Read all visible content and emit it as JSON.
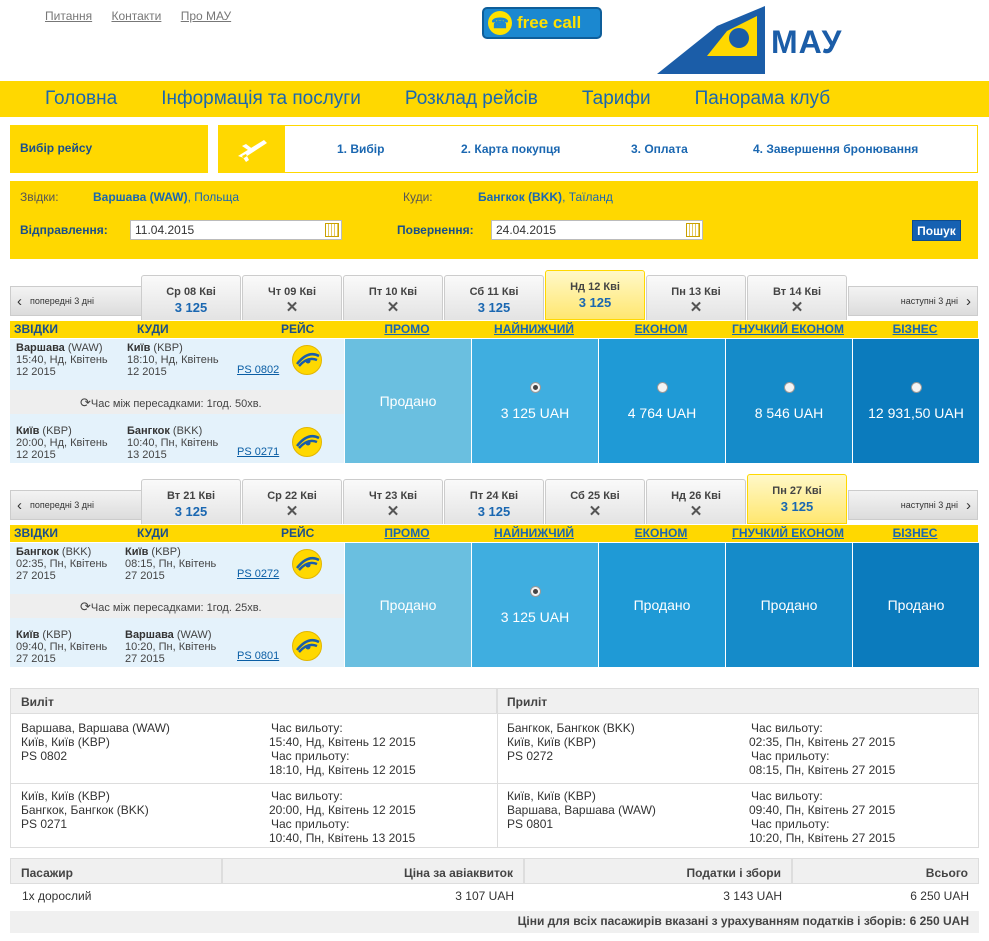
{
  "top_links": [
    "Питання",
    "Контакти",
    "Про МАУ"
  ],
  "freecall": "free call",
  "brand": "МАУ",
  "nav": [
    "Головна",
    "Інформація та послуги",
    "Розклад рейсів",
    "Тарифи",
    "Панорама клуб"
  ],
  "steps": {
    "title": "Вибір рейсу",
    "items": [
      "1. Вибір",
      "2. Карта покупця",
      "3. Оплата",
      "4. Завершення бронювання"
    ]
  },
  "search": {
    "from_label": "Звідки:",
    "from_city": "Варшава (WAW)",
    "from_country": ", Польща",
    "to_label": "Куди:",
    "to_city": "Бангкок (BKK)",
    "to_country": ", Таїланд",
    "dep_label": "Відправлення:",
    "dep_value": "11.04.2015",
    "ret_label": "Повернення:",
    "ret_value": "24.04.2015",
    "button": "Пошук"
  },
  "nav_prev": "попередні 3 дні",
  "nav_next": "наступні 3 дні",
  "columns": {
    "from": "ЗВІДКИ",
    "to": "КУДИ",
    "flight": "РЕЙС",
    "fares": [
      "ПРОМО",
      "НАЙНИЖЧИЙ",
      "ЕКОНОМ",
      "ГНУЧКИЙ ЕКОНОМ",
      "БІЗНЕС"
    ]
  },
  "outbound": {
    "dates": [
      {
        "day": "Ср 08 Кві",
        "price": "3 125"
      },
      {
        "day": "Чт 09 Кві",
        "price": ""
      },
      {
        "day": "Пт 10 Кві",
        "price": ""
      },
      {
        "day": "Сб 11 Кві",
        "price": "3 125"
      },
      {
        "day": "Нд 12 Кві",
        "price": "3 125",
        "selected": true
      },
      {
        "day": "Пн 13 Кві",
        "price": ""
      },
      {
        "day": "Вт 14 Кві",
        "price": ""
      }
    ],
    "seg1": {
      "from_city": "Варшава",
      "from_code": " (WAW)",
      "from_time": "15:40, Нд, Квітень",
      "from_year": "12 2015",
      "to_city": "Київ",
      "to_code": " (KBP)",
      "to_time": "18:10, Нд, Квітень",
      "to_year": "12 2015",
      "flight": "PS 0802"
    },
    "conn": "Час між пересадками:   1год. 50хв.",
    "seg2": {
      "from_city": "Київ",
      "from_code": " (KBP)",
      "from_time": "20:00, Нд, Квітень",
      "from_year": "12 2015",
      "to_city": "Бангкок",
      "to_code": " (BKK)",
      "to_time": "10:40, Пн, Квітень",
      "to_year": "13 2015",
      "flight": "PS 0271"
    },
    "fares": [
      {
        "text": "Продано",
        "radio": false
      },
      {
        "text": "3 125 UAH",
        "radio": true,
        "checked": true
      },
      {
        "text": "4 764 UAH",
        "radio": true
      },
      {
        "text": "8 546 UAH",
        "radio": true
      },
      {
        "text": "12 931,50 UAH",
        "radio": true
      }
    ]
  },
  "inbound": {
    "dates": [
      {
        "day": "Вт 21 Кві",
        "price": "3 125"
      },
      {
        "day": "Ср 22 Кві",
        "price": ""
      },
      {
        "day": "Чт 23 Кві",
        "price": ""
      },
      {
        "day": "Пт 24 Кві",
        "price": "3 125"
      },
      {
        "day": "Сб 25 Кві",
        "price": ""
      },
      {
        "day": "Нд 26 Кві",
        "price": ""
      },
      {
        "day": "Пн 27 Кві",
        "price": "3 125",
        "selected": true
      }
    ],
    "seg1": {
      "from_city": "Бангкок",
      "from_code": " (BKK)",
      "from_time": "02:35, Пн, Квітень",
      "from_year": "27 2015",
      "to_city": "Київ",
      "to_code": " (KBP)",
      "to_time": "08:15, Пн, Квітень",
      "to_year": "27 2015",
      "flight": "PS 0272"
    },
    "conn": "Час між пересадками:   1год. 25хв.",
    "seg2": {
      "from_city": "Київ",
      "from_code": " (KBP)",
      "from_time": "09:40, Пн, Квітень",
      "from_year": "27 2015",
      "to_city": "Варшава",
      "to_code": " (WAW)",
      "to_time": "10:20, Пн, Квітень",
      "to_year": "27 2015",
      "flight": "PS 0801"
    },
    "fares": [
      {
        "text": "Продано",
        "radio": false
      },
      {
        "text": "3 125 UAH",
        "radio": true,
        "checked": true
      },
      {
        "text": "Продано",
        "radio": false
      },
      {
        "text": "Продано",
        "radio": false
      },
      {
        "text": "Продано",
        "radio": false
      }
    ]
  },
  "summary": {
    "dep_title": "Виліт",
    "arr_title": "Приліт",
    "dep1": {
      "route1": "Варшава, Варшава (WAW)",
      "route2": "Київ, Київ (KBP)",
      "flight": "PS 0802",
      "l1": "Час вильоту:",
      "v1": "15:40, Нд, Квітень 12 2015",
      "l2": "Час прильоту:",
      "v2": "18:10, Нд, Квітень 12 2015"
    },
    "dep2": {
      "route1": "Київ, Київ (KBP)",
      "route2": "Бангкок, Бангкок (BKK)",
      "flight": "PS 0271",
      "l1": "Час вильоту:",
      "v1": "20:00, Нд, Квітень 12 2015",
      "l2": "Час прильоту:",
      "v2": "10:40, Пн, Квітень 13 2015"
    },
    "arr1": {
      "route1": "Бангкок, Бангкок (BKK)",
      "route2": "Київ, Київ (KBP)",
      "flight": "PS 0272",
      "l1": "Час вильоту:",
      "v1": "02:35, Пн, Квітень 27 2015",
      "l2": "Час прильоту:",
      "v2": "08:15, Пн, Квітень 27 2015"
    },
    "arr2": {
      "route1": "Київ, Київ (KBP)",
      "route2": "Варшава, Варшава (WAW)",
      "flight": "PS 0801",
      "l1": "Час вильоту:",
      "v1": "09:40, Пн, Квітень 27 2015",
      "l2": "Час прильоту:",
      "v2": "10:20, Пн, Квітень 27 2015"
    }
  },
  "pax": {
    "h_pax": "Пасажир",
    "h_price": "Ціна за авіаквиток",
    "h_tax": "Податки і збори",
    "h_total": "Всього",
    "pax": "1х дорослий",
    "price": "3 107 UAH",
    "tax": "3 143 UAH",
    "total": "6 250 UAH",
    "note": "Ціни для всіх пасажирів вказані з урахуванням податків і зборів: 6 250 UAH"
  },
  "colors": {
    "yellow": "#ffd800",
    "blue": "#1a67b1",
    "fare_cols": [
      "#6abfe0",
      "#3faee0",
      "#1f9ad6",
      "#158bc9",
      "#0b7bbd"
    ]
  }
}
